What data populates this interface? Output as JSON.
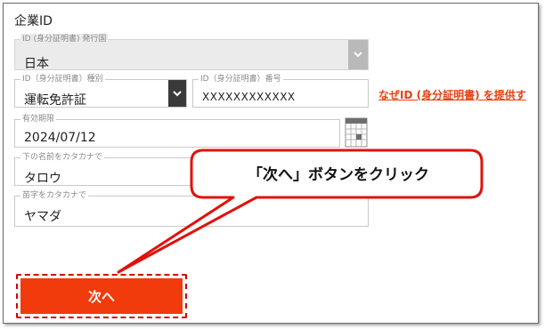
{
  "section": {
    "title": "企業ID"
  },
  "fields": {
    "country": {
      "label": "ID (身分証明書) 発行国",
      "value": "日本",
      "icon": "chevron-down-icon"
    },
    "id_type": {
      "label": "ID（身分証明書）種別",
      "value": "運転免許証",
      "icon": "chevron-down-icon"
    },
    "id_number": {
      "label": "ID（身分証明書）番号",
      "value": "XXXXXXXXXXXX"
    },
    "expiry": {
      "label": "有効期限",
      "value": "2024/07/12",
      "icon": "calendar-icon"
    },
    "first_name_kana": {
      "label": "下の名前をカタカナで",
      "value": "タロウ"
    },
    "last_name_kana": {
      "label": "苗字をカタカナで",
      "value": "ヤマダ"
    }
  },
  "links": {
    "why_id": "なぜID (身分証明書) を提供す"
  },
  "actions": {
    "next": "次へ"
  },
  "annotation": {
    "callout": "「次へ」ボタンをクリック"
  },
  "colors": {
    "accent": "#f13b0c",
    "callout_border": "#e0120b",
    "link": "#e8410f"
  }
}
